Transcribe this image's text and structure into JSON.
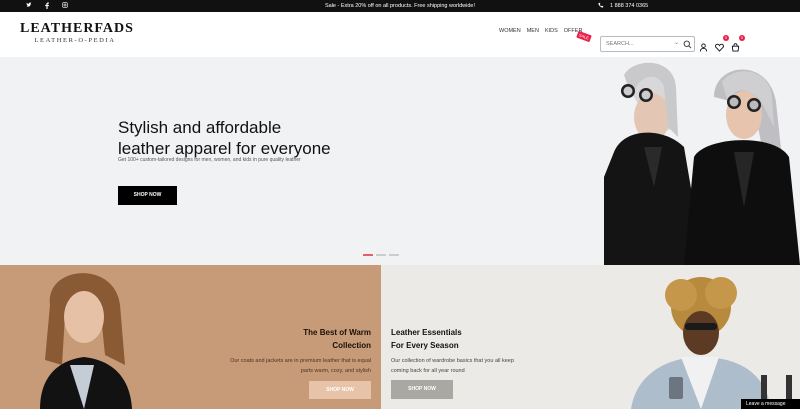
{
  "topbar": {
    "social": [
      "twitter-icon",
      "facebook-icon",
      "instagram-icon"
    ],
    "promo": "Sale - Extra 20% off on all products. Free shipping worldwide!",
    "phone": "1 888 374 0365"
  },
  "header": {
    "logo_main": "LEATHERFADS",
    "logo_sub": "LEATHER-O-PEDIA",
    "nav": [
      "WOMEN",
      "MEN",
      "KIDS",
      "OFFER"
    ],
    "sale_tag": "SALE",
    "search_placeholder": "SEARCH...",
    "wishlist_count": "0",
    "cart_count": "0"
  },
  "hero": {
    "title_line1": "Stylish and affordable",
    "title_line2": "leather apparel for everyone",
    "subtitle": "Get 100+ custom-tailored designs for men, women, and kids in pure quality leather",
    "button": "SHOP NOW"
  },
  "promo_left": {
    "title_line1": "The Best of Warm",
    "title_line2": "Collection",
    "desc_line1": "Our coats and jackets are in premium leather that is equal",
    "desc_line2": "parts warm, cozy, and stylish",
    "button": "SHOP NOW"
  },
  "promo_right": {
    "title_line1": "Leather Essentials",
    "title_line2": "For Every Season",
    "desc_line1": "Our collection of wardrobe basics that you all keep",
    "desc_line2": "coming back for all year round",
    "button": "SHOP NOW"
  },
  "chat": {
    "label": "Leave a message"
  },
  "colors": {
    "accent": "#e8214a",
    "promo_left_bg": "#c79a78",
    "promo_right_bg": "#ebeae6"
  }
}
